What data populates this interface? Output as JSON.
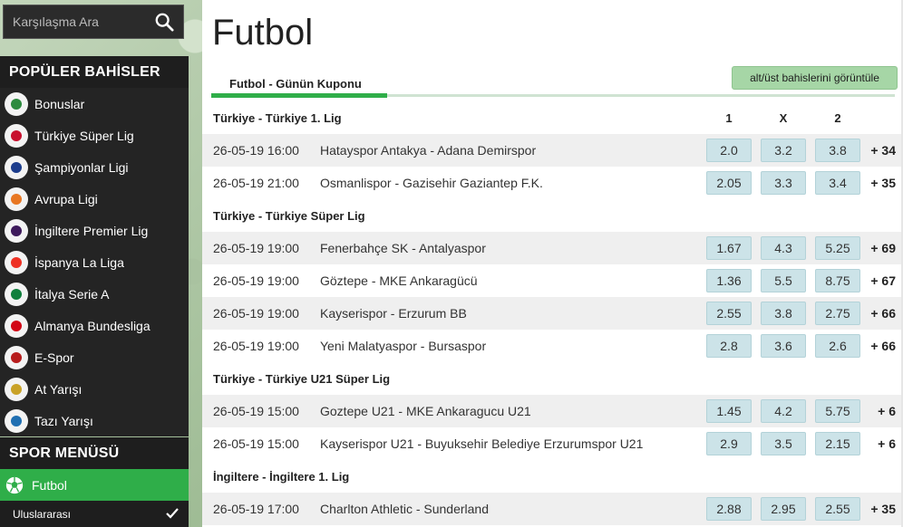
{
  "search": {
    "placeholder": "Karşılaşma Ara"
  },
  "sidebar": {
    "popular_title": "POPÜLER BAHİSLER",
    "items": [
      {
        "label": "Bonuslar",
        "icon": "gift-icon",
        "color": "#2c8b3e"
      },
      {
        "label": "Türkiye Süper Lig",
        "icon": "super-lig-icon",
        "color": "#c8102e"
      },
      {
        "label": "Şampiyonlar Ligi",
        "icon": "champions-league-icon",
        "color": "#1c3c8c"
      },
      {
        "label": "Avrupa Ligi",
        "icon": "europa-league-icon",
        "color": "#e87722"
      },
      {
        "label": "İngiltere Premier Lig",
        "icon": "premier-league-icon",
        "color": "#3d195b"
      },
      {
        "label": "İspanya La Liga",
        "icon": "la-liga-icon",
        "color": "#ee3124"
      },
      {
        "label": "İtalya Serie A",
        "icon": "serie-a-icon",
        "color": "#0f7f3c"
      },
      {
        "label": "Almanya Bundesliga",
        "icon": "bundesliga-icon",
        "color": "#d20515"
      },
      {
        "label": "E-Spor",
        "icon": "esport-icon",
        "color": "#b71c1c"
      },
      {
        "label": "At Yarışı",
        "icon": "horse-racing-icon",
        "color": "#c9a227"
      },
      {
        "label": "Tazı Yarışı",
        "icon": "greyhound-icon",
        "color": "#1f6fb2"
      }
    ],
    "sport_menu_title": "SPOR MENÜSÜ",
    "active_sport": "Futbol",
    "sub_item": "Uluslararası"
  },
  "main": {
    "title": "Futbol",
    "tab_label": "Futbol - Günün Kuponu",
    "ou_button": "alt/üst bahislerini görüntüle",
    "col_1": "1",
    "col_x": "X",
    "col_2": "2",
    "leagues": [
      {
        "name": "Türkiye - Türkiye 1. Lig",
        "matches": [
          {
            "date": "26-05-19 16:00",
            "teams": "Hatayspor Antakya - Adana Demirspor",
            "o1": "2.0",
            "ox": "3.2",
            "o2": "3.8",
            "more": "+ 34"
          },
          {
            "date": "26-05-19 21:00",
            "teams": "Osmanlispor - Gazisehir Gaziantep F.K.",
            "o1": "2.05",
            "ox": "3.3",
            "o2": "3.4",
            "more": "+ 35"
          }
        ]
      },
      {
        "name": "Türkiye - Türkiye Süper Lig",
        "matches": [
          {
            "date": "26-05-19 19:00",
            "teams": "Fenerbahçe SK - Antalyaspor",
            "o1": "1.67",
            "ox": "4.3",
            "o2": "5.25",
            "more": "+ 69"
          },
          {
            "date": "26-05-19 19:00",
            "teams": "Göztepe - MKE Ankaragücü",
            "o1": "1.36",
            "ox": "5.5",
            "o2": "8.75",
            "more": "+ 67"
          },
          {
            "date": "26-05-19 19:00",
            "teams": "Kayserispor - Erzurum BB",
            "o1": "2.55",
            "ox": "3.8",
            "o2": "2.75",
            "more": "+ 66"
          },
          {
            "date": "26-05-19 19:00",
            "teams": "Yeni Malatyaspor - Bursaspor",
            "o1": "2.8",
            "ox": "3.6",
            "o2": "2.6",
            "more": "+ 66"
          }
        ]
      },
      {
        "name": "Türkiye - Türkiye U21 Süper Lig",
        "matches": [
          {
            "date": "26-05-19 15:00",
            "teams": "Goztepe U21 - MKE Ankaragucu U21",
            "o1": "1.45",
            "ox": "4.2",
            "o2": "5.75",
            "more": "+ 6"
          },
          {
            "date": "26-05-19 15:00",
            "teams": "Kayserispor U21 - Buyuksehir Belediye Erzurumspor U21",
            "o1": "2.9",
            "ox": "3.5",
            "o2": "2.15",
            "more": "+ 6"
          }
        ]
      },
      {
        "name": "İngiltere - İngiltere 1. Lig",
        "matches": [
          {
            "date": "26-05-19 17:00",
            "teams": "Charlton Athletic - Sunderland",
            "o1": "2.88",
            "ox": "2.95",
            "o2": "2.55",
            "more": "+ 35"
          }
        ]
      }
    ]
  }
}
